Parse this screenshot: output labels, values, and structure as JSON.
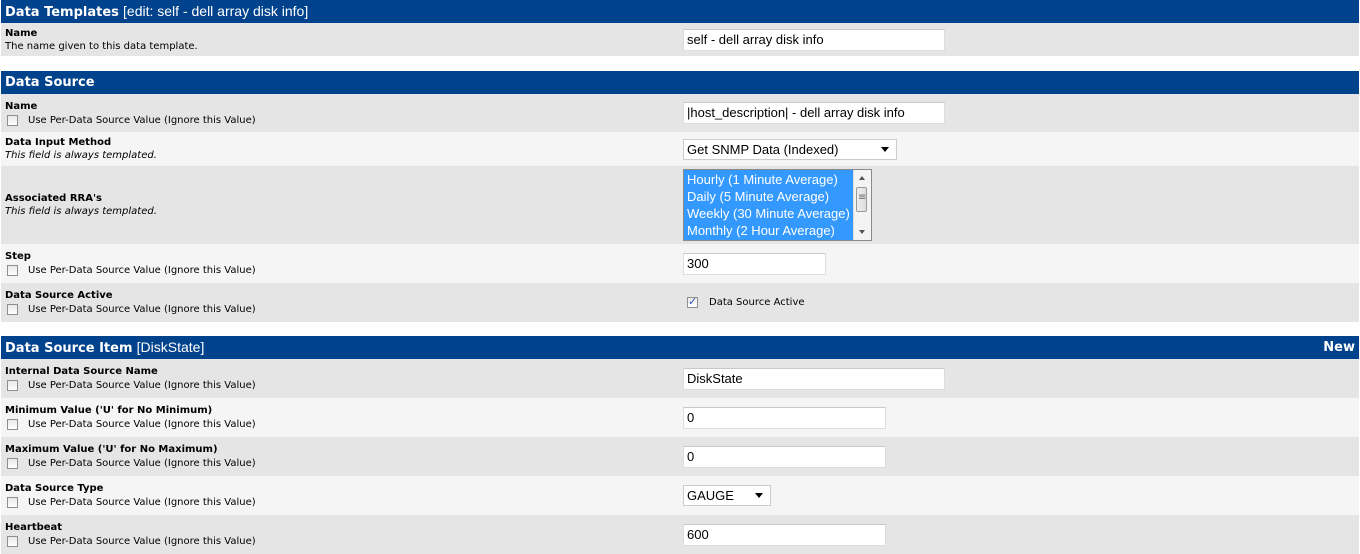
{
  "template_section": {
    "title": "Data Templates",
    "subtitle": "[edit: self - dell array disk info]",
    "name_label": "Name",
    "name_desc": "The name given to this data template.",
    "name_value": "self - dell array disk info"
  },
  "data_source": {
    "title": "Data Source",
    "per_ds_label": "Use Per-Data Source Value (Ignore this Value)",
    "always_templated": "This field is always templated.",
    "name": {
      "label": "Name",
      "value": "|host_description| - dell array disk info"
    },
    "input_method": {
      "label": "Data Input Method",
      "value": "Get SNMP Data (Indexed)"
    },
    "rras": {
      "label": "Associated RRA's",
      "options": [
        "Hourly (1 Minute Average)",
        "Daily (5 Minute Average)",
        "Weekly (30 Minute Average)",
        "Monthly (2 Hour Average)"
      ]
    },
    "step": {
      "label": "Step",
      "value": "300"
    },
    "active": {
      "label": "Data Source Active",
      "checkbox_label": "Data Source Active",
      "checked": true
    }
  },
  "ds_item": {
    "title": "Data Source Item",
    "subtitle": "[DiskState]",
    "new_link": "New",
    "internal_name": {
      "label": "Internal Data Source Name",
      "value": "DiskState"
    },
    "min": {
      "label": "Minimum Value ('U' for No Minimum)",
      "value": "0"
    },
    "max": {
      "label": "Maximum Value ('U' for No Maximum)",
      "value": "0"
    },
    "type": {
      "label": "Data Source Type",
      "value": "GAUGE"
    },
    "heartbeat": {
      "label": "Heartbeat",
      "value": "600"
    }
  }
}
